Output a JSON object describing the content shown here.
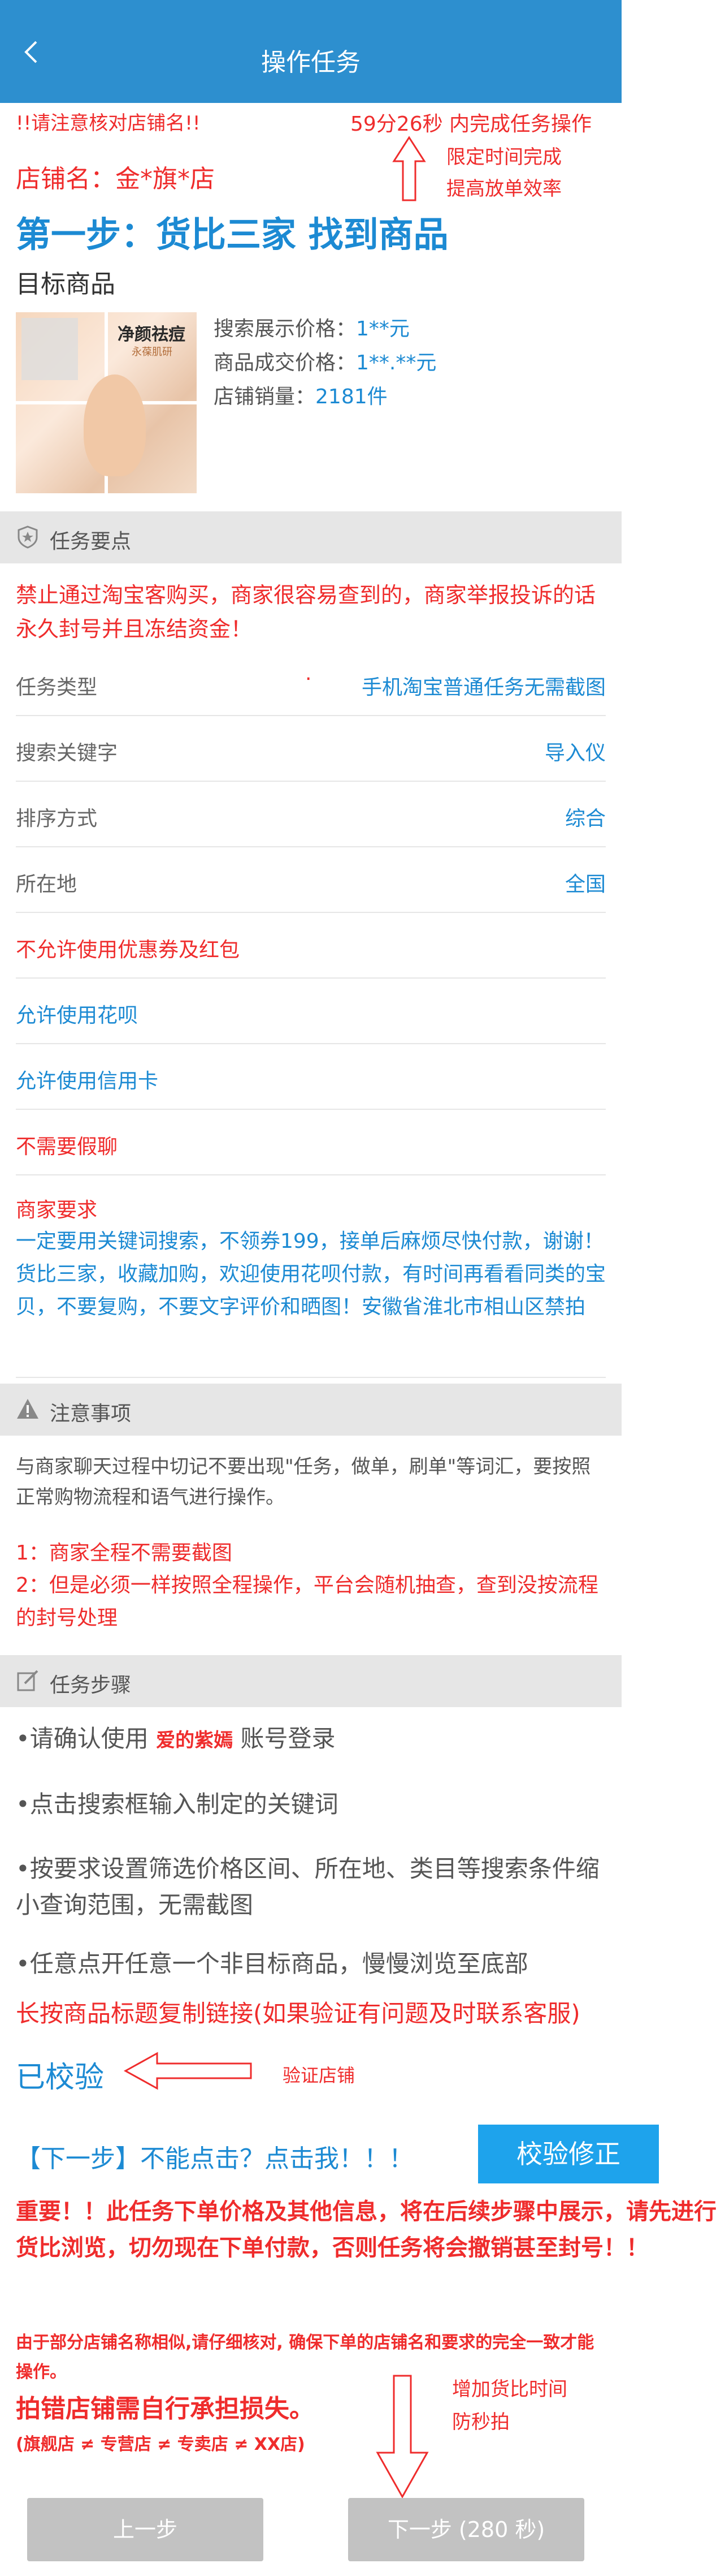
{
  "header": {
    "title": "操作任务"
  },
  "notice_top": "!!请注意核对店铺名!!",
  "timer": "59分26秒 内完成任务操作",
  "annot_time": [
    "限定时间完成",
    "提高放单效率"
  ],
  "store_label": "店铺名：金*旗*店",
  "step1_title": "第一步：货比三家 找到商品",
  "target_label": "目标商品",
  "product": {
    "image_text": "净颜祛痘",
    "image_subtext": "永葆肌研",
    "price_display_label": "搜索展示价格：",
    "price_display_value": "1**元",
    "price_deal_label": "商品成交价格：",
    "price_deal_value": "1**.**元",
    "sales_label": "店铺销量：",
    "sales_value": "2181件"
  },
  "task_points": {
    "header": "任务要点",
    "warning": "禁止通过淘宝客购买，商家很容易查到的，商家举报投诉的话永久封号并且冻结资金！",
    "rows": [
      {
        "k": "任务类型",
        "dot": "·",
        "v": "手机淘宝普通任务无需截图"
      },
      {
        "k": "搜索关键字",
        "v": "导入仪"
      },
      {
        "k": "排序方式",
        "v": "综合"
      },
      {
        "k": "所在地",
        "v": "全国"
      }
    ],
    "rules": [
      "不允许使用优惠券及红包",
      "允许使用花呗",
      "允许使用信用卡",
      "不需要假聊"
    ],
    "merchant_req_label": "商家要求",
    "merchant_req": "一定要用关键词搜索，不领券199，接单后麻烦尽快付款，谢谢！货比三家，收藏加购，欢迎使用花呗付款，有时间再看看同类的宝贝，不要复购，不要文字评价和晒图！安徽省淮北市相山区禁拍"
  },
  "notes": {
    "header": "注意事项",
    "text": "与商家聊天过程中切记不要出现\"任务，做单，刷单\"等词汇，要按照正常购物流程和语气进行操作。",
    "red1": "1：商家全程不需要截图",
    "red2": "2：但是必须一样按照全程操作，平台会随机抽查，查到没按流程的封号处理"
  },
  "steps": {
    "header": "任务步骤",
    "s1_pre": "•请确认使用",
    "s1_account": "爱的紫嫣",
    "s1_post": "账号登录",
    "s2": "•点击搜索框输入制定的关键词",
    "s3": "•按要求设置筛选价格区间、所在地、类目等搜索条件缩小查询范围，无需截图",
    "s4": "•任意点开任意一个非目标商品，慢慢浏览至底部",
    "copy_link": "长按商品标题复制链接(如果验证有问题及时联系客服)",
    "verified": "已校验",
    "verify_annot": "验证店铺"
  },
  "next_hint": "【下一步】不能点击？点击我！！！",
  "verify_btn": "校验修正",
  "important": "重要！！此任务下单价格及其他信息，将在后续步骤中展示，请先进行货比浏览，切勿现在下单付款，否则任务将会撤销甚至封号！！",
  "similar": "由于部分店铺名称相似,请仔细核对, 确保下单的店铺名和要求的完全一致才能操作。",
  "wrong_store": "拍错店铺需自行承担损失。",
  "store_types": "(旗舰店 ≠ 专营店 ≠ 专卖店 ≠ XX店)",
  "annot_bottom": [
    "增加货比时间",
    "防秒拍"
  ],
  "footer": {
    "prev": "上一步",
    "next": "下一步 (280 秒)"
  },
  "colors": {
    "header": "#2d8fcf",
    "red": "#ef2c2c",
    "blue": "#1c8ad3",
    "button_gray": "#c2c2c2",
    "verify_button": "#1ea3ec"
  }
}
